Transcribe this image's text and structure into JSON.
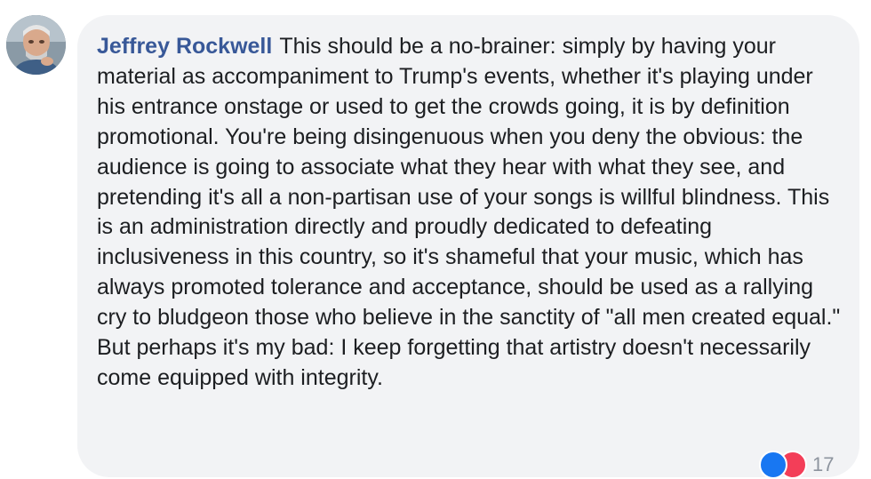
{
  "comment": {
    "author": "Jeffrey Rockwell",
    "text": "This should be a no-brainer: simply by having your material as accompaniment to Trump's events, whether it's playing under his entrance onstage or used to get the crowds going, it is by definition promotional. You're being disingenuous when you deny the obvious: the audience is going to associate what they hear with what they see, and pretending it's all a non-partisan use of your songs is willful blindness. This is an administration directly and proudly dedicated to defeating inclusiveness in this country, so it's shameful that your music, which has always promoted tolerance and acceptance, should be used as a rallying cry to bludgeon those who believe in the sanctity of \"all men created equal.\" But perhaps it's my bad: I keep forgetting that artistry doesn't necessarily come equipped with integrity."
  },
  "reactions": {
    "icons": [
      "like-icon",
      "love-icon"
    ],
    "count": "17"
  },
  "colors": {
    "bubble_bg": "#f2f3f5",
    "author_link": "#385898",
    "text": "#1c1e21",
    "like": "#1877f2",
    "love": "#f33e58"
  }
}
